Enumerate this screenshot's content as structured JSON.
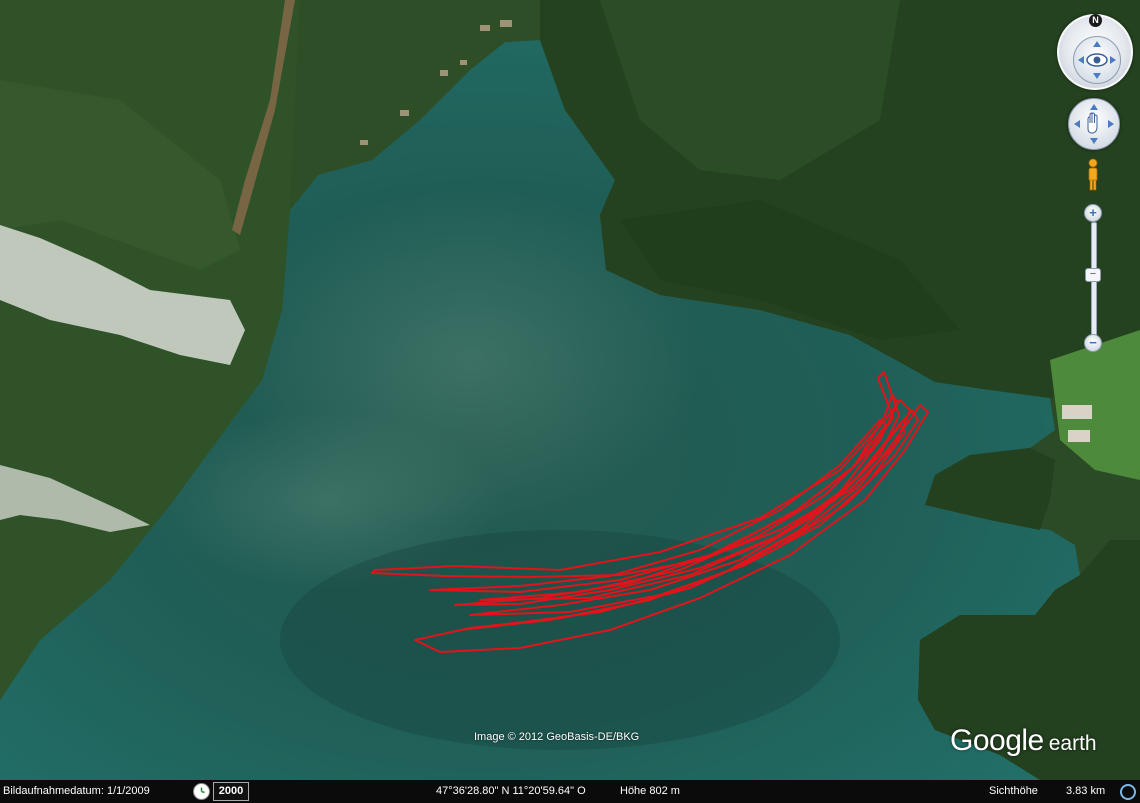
{
  "copyright": "Image © 2012 GeoBasis-DE/BKG",
  "logo": {
    "google": "Google",
    "earth": "earth"
  },
  "status": {
    "date_label": "Bildaufnahmedatum: 1/1/2009",
    "year": "2000",
    "coords": "47°36'28.80\" N  11°20'59.64\" O",
    "elevation": "Höhe   802 m",
    "eye_label": "Sichthöhe",
    "eye_value": "3.83 km"
  },
  "nav": {
    "north": "N",
    "zoom_in": "+",
    "zoom_out": "−"
  },
  "colors": {
    "track": "#e0141a",
    "water": "#1f6359",
    "forest": "#2a4a24"
  }
}
